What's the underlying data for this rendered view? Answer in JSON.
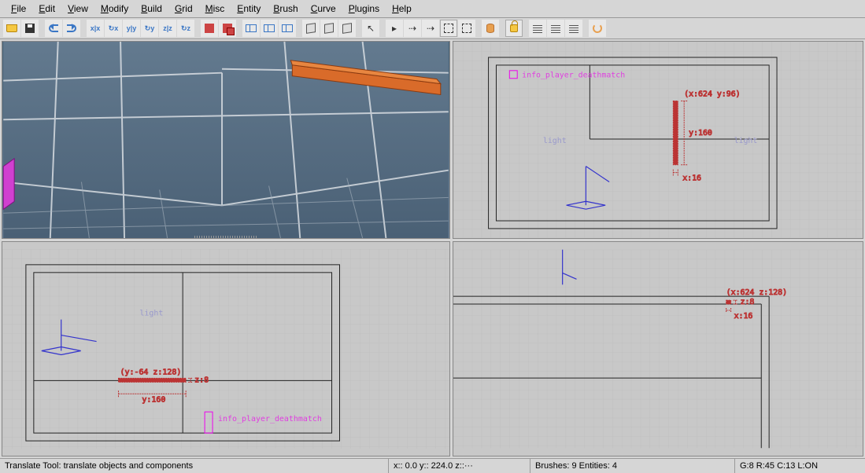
{
  "menu": [
    "File",
    "Edit",
    "View",
    "Modify",
    "Build",
    "Grid",
    "Misc",
    "Entity",
    "Brush",
    "Curve",
    "Plugins",
    "Help"
  ],
  "viewports": {
    "top_right": {
      "entity_label": "info_player_deathmatch",
      "coord": "(x:624  y:96)",
      "dim1": "y:160",
      "dim2": "x:16",
      "light1": "light",
      "light2": "light"
    },
    "bottom_left": {
      "entity_label": "info_player_deathmatch",
      "coord": "(y:-64  z:128)",
      "dim1": "z:8",
      "dim2": "y:160",
      "light": "light"
    },
    "bottom_right": {
      "coord": "(x:624  z:128)",
      "dim1": "z:8",
      "dim2": "x:16"
    }
  },
  "status": {
    "tool": "Translate Tool: translate objects and components",
    "coords": "x::   0.0  y::  224.0  z::···",
    "counts": "Brushes: 9 Entities: 4",
    "grid": "G:8  R:45  C:13  L:ON"
  }
}
